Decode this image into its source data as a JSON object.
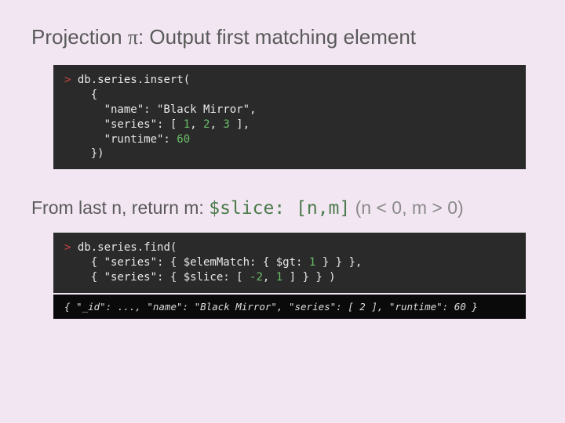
{
  "title": {
    "prefix": "Projection ",
    "pi": "π",
    "suffix": ": Output first matching element"
  },
  "code1": {
    "prompt": ">",
    "l1": " db.series.insert(",
    "l2": "    {",
    "l3": "      \"name\": \"Black Mirror\",",
    "l4a": "      \"series\": [ ",
    "n1": "1",
    "s1": ", ",
    "n2": "2",
    "s2": ", ",
    "n3": "3",
    "l4b": " ],",
    "l5a": "      \"runtime\": ",
    "n60": "60",
    "l6": "    })"
  },
  "subtitle": {
    "text": "From last n, return m:   ",
    "slice": "$slice: [n,m]",
    "args": " (n < 0, m > 0)"
  },
  "code2": {
    "prompt": ">",
    "l1": " db.series.find(",
    "l2a": "    { \"series\": { $elemMatch: { $gt: ",
    "n1": "1",
    "l2b": " } } },",
    "l3a": "    { \"series\": { $slice: [ ",
    "nm2": "-2",
    "c1": ", ",
    "np1": "1",
    "l3b": " ] } } )"
  },
  "result": "{ \"_id\": ..., \"name\": \"Black Mirror\", \"series\": [ 2 ], \"runtime\": 60 }"
}
